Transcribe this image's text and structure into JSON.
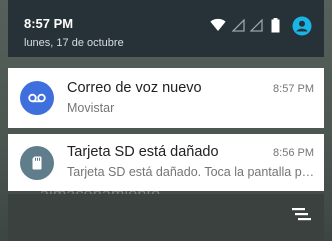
{
  "header": {
    "time": "8:57 PM",
    "date": "lunes, 17 de octubre"
  },
  "status_icons": [
    "wifi-icon",
    "signal-icon",
    "signal-icon",
    "battery-icon",
    "account-icon"
  ],
  "notifications": [
    {
      "icon": "voicemail-icon",
      "title": "Correo de voz nuevo",
      "time": "8:57 PM",
      "subtitle": "Movistar",
      "accent": "#3f6fdc"
    },
    {
      "icon": "sd-card-icon",
      "title": "Tarjeta SD está dañado",
      "time": "8:56 PM",
      "subtitle": "Tarjeta SD está dañado. Toca la pantalla para corregirlo.",
      "accent": "#607d8b"
    }
  ],
  "background": {
    "text": "almacenamiento"
  },
  "colors": {
    "shade": "#263238",
    "account": "#19b5e6"
  }
}
